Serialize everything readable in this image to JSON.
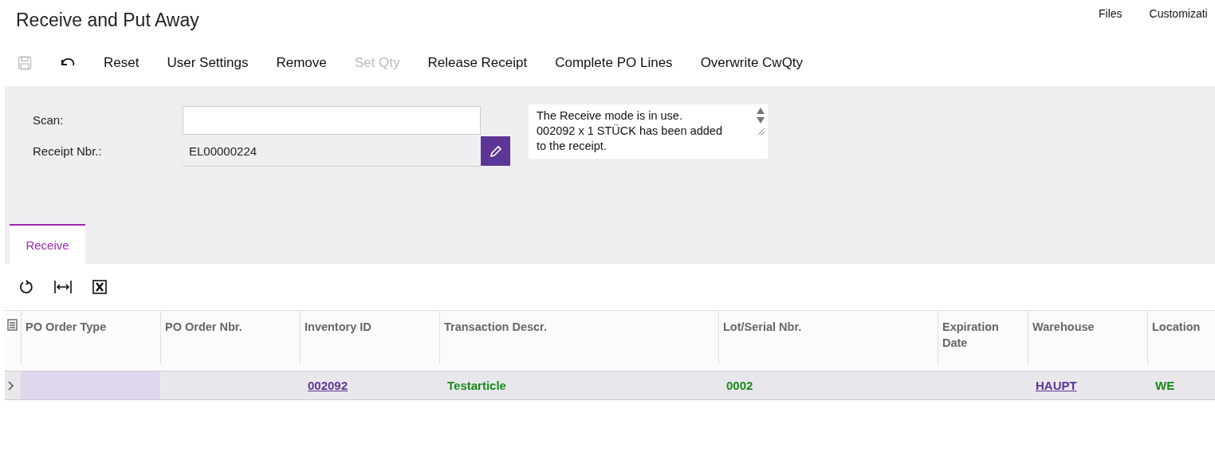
{
  "title": "Receive and Put Away",
  "top_links": [
    "Files",
    "Customizati"
  ],
  "toolbar": [
    {
      "kind": "save",
      "disabled": true
    },
    {
      "kind": "undo",
      "disabled": false
    },
    {
      "kind": "text",
      "label": "Reset",
      "disabled": false
    },
    {
      "kind": "text",
      "label": "User Settings",
      "disabled": false
    },
    {
      "kind": "text",
      "label": "Remove",
      "disabled": false
    },
    {
      "kind": "text",
      "label": "Set Qty",
      "disabled": true
    },
    {
      "kind": "text",
      "label": "Release Receipt",
      "disabled": false
    },
    {
      "kind": "text",
      "label": "Complete PO Lines",
      "disabled": false
    },
    {
      "kind": "text",
      "label": "Overwrite CwQty",
      "disabled": false
    }
  ],
  "form": {
    "scan": {
      "label": "Scan:"
    },
    "receipt": {
      "label": "Receipt Nbr.:",
      "value": "EL00000224"
    },
    "message_lines": [
      "The Receive mode is in use.",
      "002092 x 1 STÜCK has been added",
      "to the receipt."
    ]
  },
  "tabs": [
    {
      "label": "Receive",
      "selected": true
    }
  ],
  "table": {
    "columns": [
      "PO Order Type",
      "PO Order Nbr.",
      "Inventory ID",
      "Transaction Descr.",
      "Lot/Serial Nbr.",
      "Expiration Date",
      "Warehouse",
      "Location"
    ],
    "rows": [
      {
        "selected": true,
        "cells": [
          {
            "kind": "empty"
          },
          {
            "kind": "empty"
          },
          {
            "kind": "link",
            "text": "002092"
          },
          {
            "kind": "green",
            "text": "Testarticle"
          },
          {
            "kind": "green",
            "text": "0002"
          },
          {
            "kind": "empty"
          },
          {
            "kind": "link",
            "text": "HAUPT"
          },
          {
            "kind": "green",
            "text": "WE"
          }
        ]
      }
    ]
  }
}
